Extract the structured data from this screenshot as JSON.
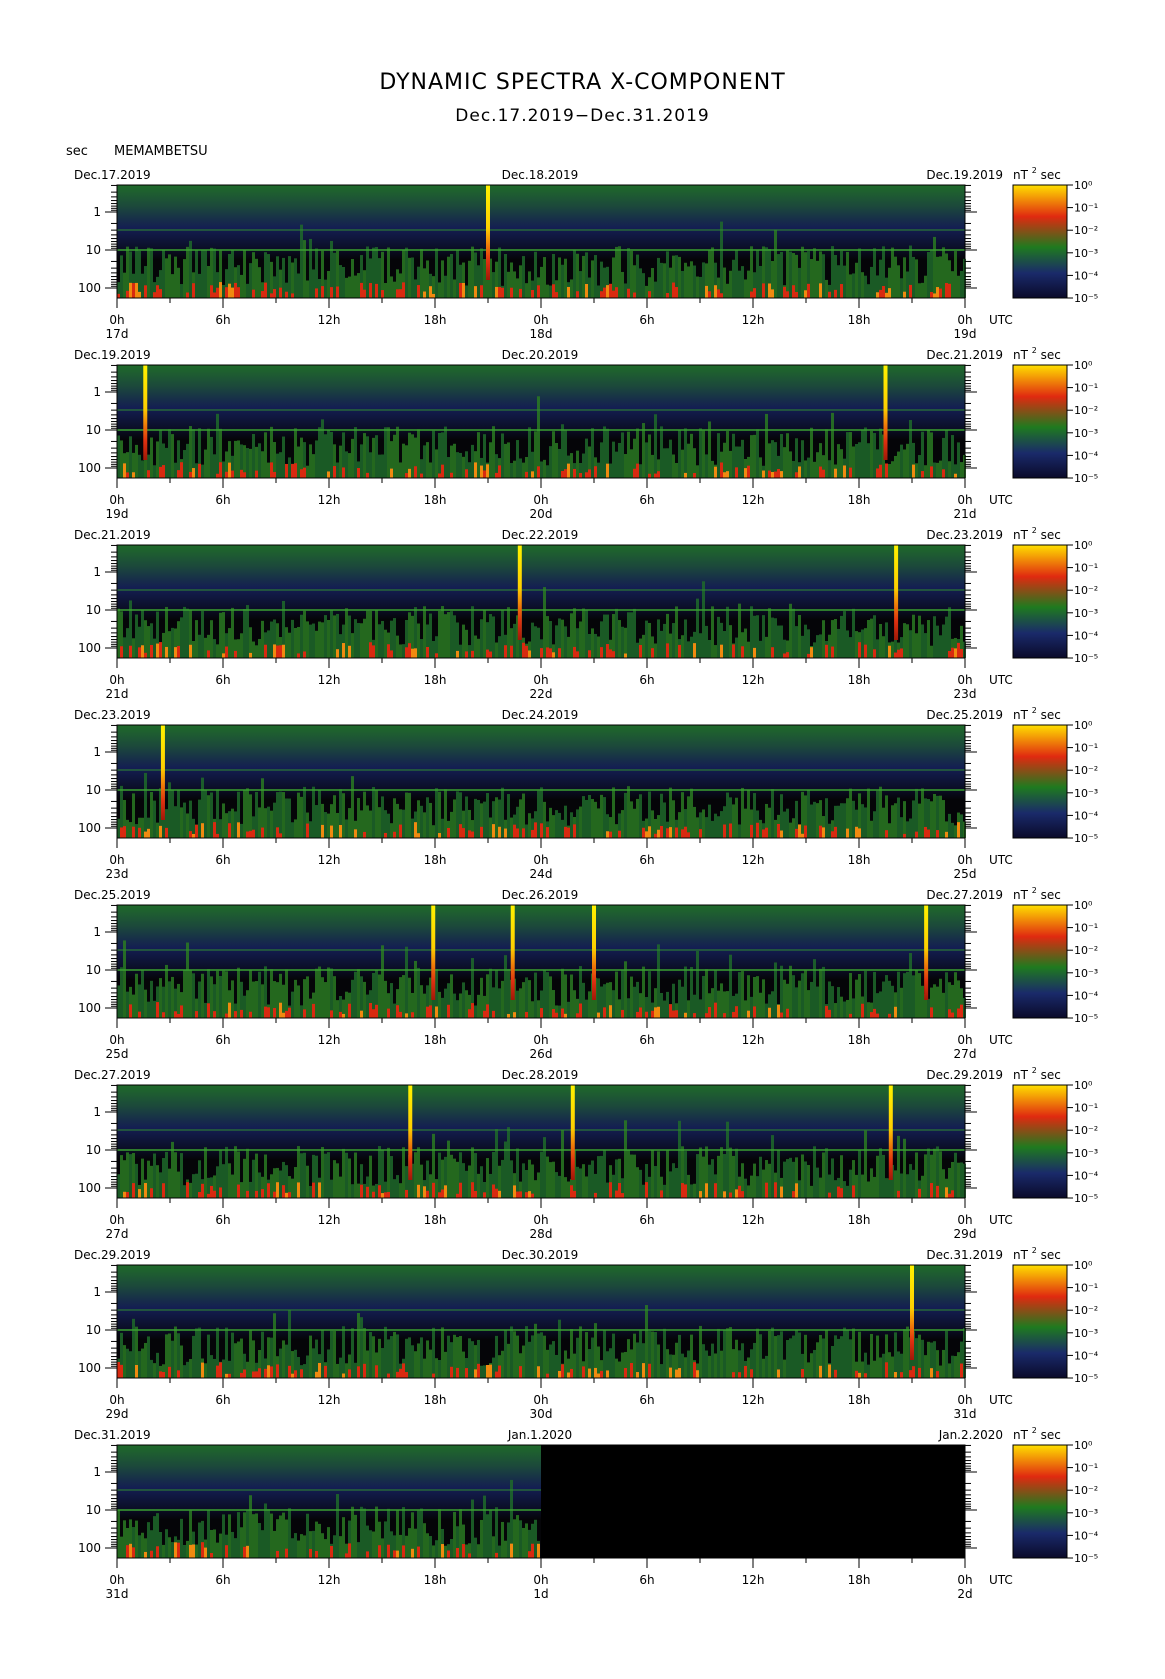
{
  "title": "DYNAMIC SPECTRA X-COMPONENT",
  "subtitle": "Dec.17.2019−Dec.31.2019",
  "y_unit": "sec",
  "station": "MEMAMBETSU",
  "power_unit": "nT",
  "power_unit_exp": "2",
  "power_unit_suffix": "sec",
  "utc_label": "UTC",
  "colormap": [
    "#0a0a2a",
    "#1a2a6a",
    "#1f7a1f",
    "#e02a10",
    "#ffe000"
  ],
  "chart_data": [
    {
      "type": "heatmap",
      "start_label": "Dec.17.2019",
      "mid_label": "Dec.18.2019",
      "end_label": "Dec.19.2019",
      "x_ticks": [
        "0h",
        "6h",
        "12h",
        "18h",
        "0h",
        "6h",
        "12h",
        "18h",
        "0h"
      ],
      "day_labels": [
        "17d",
        "18d",
        "19d"
      ],
      "y_ticks": [
        "1",
        "10",
        "100"
      ],
      "colorbar_ticks": [
        "10⁰",
        "10⁻¹",
        "10⁻²",
        "10⁻³",
        "10⁻⁴",
        "10⁻⁵"
      ],
      "spikes_hours": [
        21.0
      ],
      "data_coverage_hours": 48
    },
    {
      "type": "heatmap",
      "start_label": "Dec.19.2019",
      "mid_label": "Dec.20.2019",
      "end_label": "Dec.21.2019",
      "x_ticks": [
        "0h",
        "6h",
        "12h",
        "18h",
        "0h",
        "6h",
        "12h",
        "18h",
        "0h"
      ],
      "day_labels": [
        "19d",
        "20d",
        "21d"
      ],
      "y_ticks": [
        "1",
        "10",
        "100"
      ],
      "colorbar_ticks": [
        "10⁰",
        "10⁻¹",
        "10⁻²",
        "10⁻³",
        "10⁻⁴",
        "10⁻⁵"
      ],
      "spikes_hours": [
        1.6,
        43.5
      ],
      "data_coverage_hours": 48
    },
    {
      "type": "heatmap",
      "start_label": "Dec.21.2019",
      "mid_label": "Dec.22.2019",
      "end_label": "Dec.23.2019",
      "x_ticks": [
        "0h",
        "6h",
        "12h",
        "18h",
        "0h",
        "6h",
        "12h",
        "18h",
        "0h"
      ],
      "day_labels": [
        "21d",
        "22d",
        "23d"
      ],
      "y_ticks": [
        "1",
        "10",
        "100"
      ],
      "colorbar_ticks": [
        "10⁰",
        "10⁻¹",
        "10⁻²",
        "10⁻³",
        "10⁻⁴",
        "10⁻⁵"
      ],
      "spikes_hours": [
        22.8,
        44.1
      ],
      "data_coverage_hours": 48
    },
    {
      "type": "heatmap",
      "start_label": "Dec.23.2019",
      "mid_label": "Dec.24.2019",
      "end_label": "Dec.25.2019",
      "x_ticks": [
        "0h",
        "6h",
        "12h",
        "18h",
        "0h",
        "6h",
        "12h",
        "18h",
        "0h"
      ],
      "day_labels": [
        "23d",
        "24d",
        "25d"
      ],
      "y_ticks": [
        "1",
        "10",
        "100"
      ],
      "colorbar_ticks": [
        "10⁰",
        "10⁻¹",
        "10⁻²",
        "10⁻³",
        "10⁻⁴",
        "10⁻⁵"
      ],
      "spikes_hours": [
        2.6
      ],
      "data_coverage_hours": 48
    },
    {
      "type": "heatmap",
      "start_label": "Dec.25.2019",
      "mid_label": "Dec.26.2019",
      "end_label": "Dec.27.2019",
      "x_ticks": [
        "0h",
        "6h",
        "12h",
        "18h",
        "0h",
        "6h",
        "12h",
        "18h",
        "0h"
      ],
      "day_labels": [
        "25d",
        "26d",
        "27d"
      ],
      "y_ticks": [
        "1",
        "10",
        "100"
      ],
      "colorbar_ticks": [
        "10⁰",
        "10⁻¹",
        "10⁻²",
        "10⁻³",
        "10⁻⁴",
        "10⁻⁵"
      ],
      "spikes_hours": [
        17.9,
        22.4,
        27.0,
        45.8
      ],
      "data_coverage_hours": 48
    },
    {
      "type": "heatmap",
      "start_label": "Dec.27.2019",
      "mid_label": "Dec.28.2019",
      "end_label": "Dec.29.2019",
      "x_ticks": [
        "0h",
        "6h",
        "12h",
        "18h",
        "0h",
        "6h",
        "12h",
        "18h",
        "0h"
      ],
      "day_labels": [
        "27d",
        "28d",
        "29d"
      ],
      "y_ticks": [
        "1",
        "10",
        "100"
      ],
      "colorbar_ticks": [
        "10⁰",
        "10⁻¹",
        "10⁻²",
        "10⁻³",
        "10⁻⁴",
        "10⁻⁵"
      ],
      "spikes_hours": [
        16.6,
        25.8,
        43.8
      ],
      "data_coverage_hours": 48
    },
    {
      "type": "heatmap",
      "start_label": "Dec.29.2019",
      "mid_label": "Dec.30.2019",
      "end_label": "Dec.31.2019",
      "x_ticks": [
        "0h",
        "6h",
        "12h",
        "18h",
        "0h",
        "6h",
        "12h",
        "18h",
        "0h"
      ],
      "day_labels": [
        "29d",
        "30d",
        "31d"
      ],
      "y_ticks": [
        "1",
        "10",
        "100"
      ],
      "colorbar_ticks": [
        "10⁰",
        "10⁻¹",
        "10⁻²",
        "10⁻³",
        "10⁻⁴",
        "10⁻⁵"
      ],
      "spikes_hours": [
        45.0
      ],
      "data_coverage_hours": 48
    },
    {
      "type": "heatmap",
      "start_label": "Dec.31.2019",
      "mid_label": "Jan.1.2020",
      "end_label": "Jan.2.2020",
      "x_ticks": [
        "0h",
        "6h",
        "12h",
        "18h",
        "0h",
        "6h",
        "12h",
        "18h",
        "0h"
      ],
      "day_labels": [
        "31d",
        "1d",
        "2d"
      ],
      "y_ticks": [
        "1",
        "10",
        "100"
      ],
      "colorbar_ticks": [
        "10⁰",
        "10⁻¹",
        "10⁻²",
        "10⁻³",
        "10⁻⁴",
        "10⁻⁵"
      ],
      "spikes_hours": [],
      "data_coverage_hours": 24
    }
  ]
}
